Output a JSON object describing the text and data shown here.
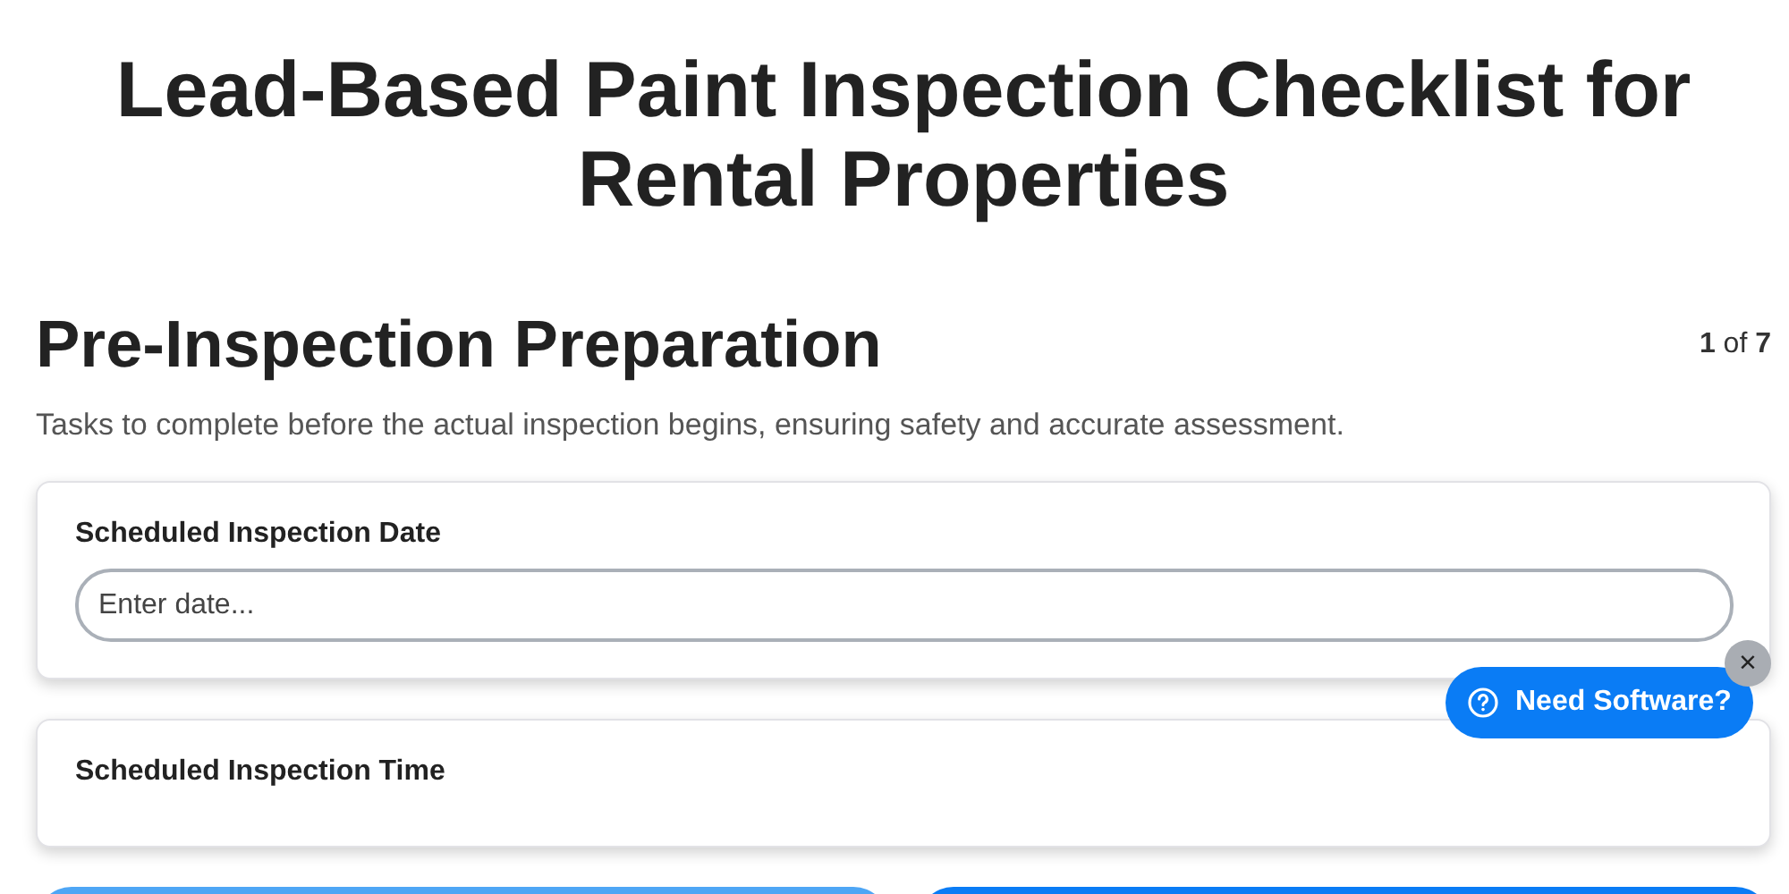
{
  "title": "Lead-Based Paint Inspection Checklist for Rental Properties",
  "section": {
    "heading": "Pre-Inspection Preparation",
    "progress": "**1** of **7**",
    "description": "Tasks to complete before the actual inspection begins, ensuring safety and accurate assessment."
  },
  "items": [
    {
      "kind": "text",
      "label": "Scheduled Inspection Date",
      "placeholder": "Enter date..."
    },
    {
      "kind": "label",
      "label": "Scheduled Inspection Time"
    }
  ],
  "buttons": [
    {
      "kind": "secondary"
    },
    {
      "kind": "primary"
    }
  ],
  "help_widget": {
    "label": "Need Software?",
    "close": "×"
  }
}
